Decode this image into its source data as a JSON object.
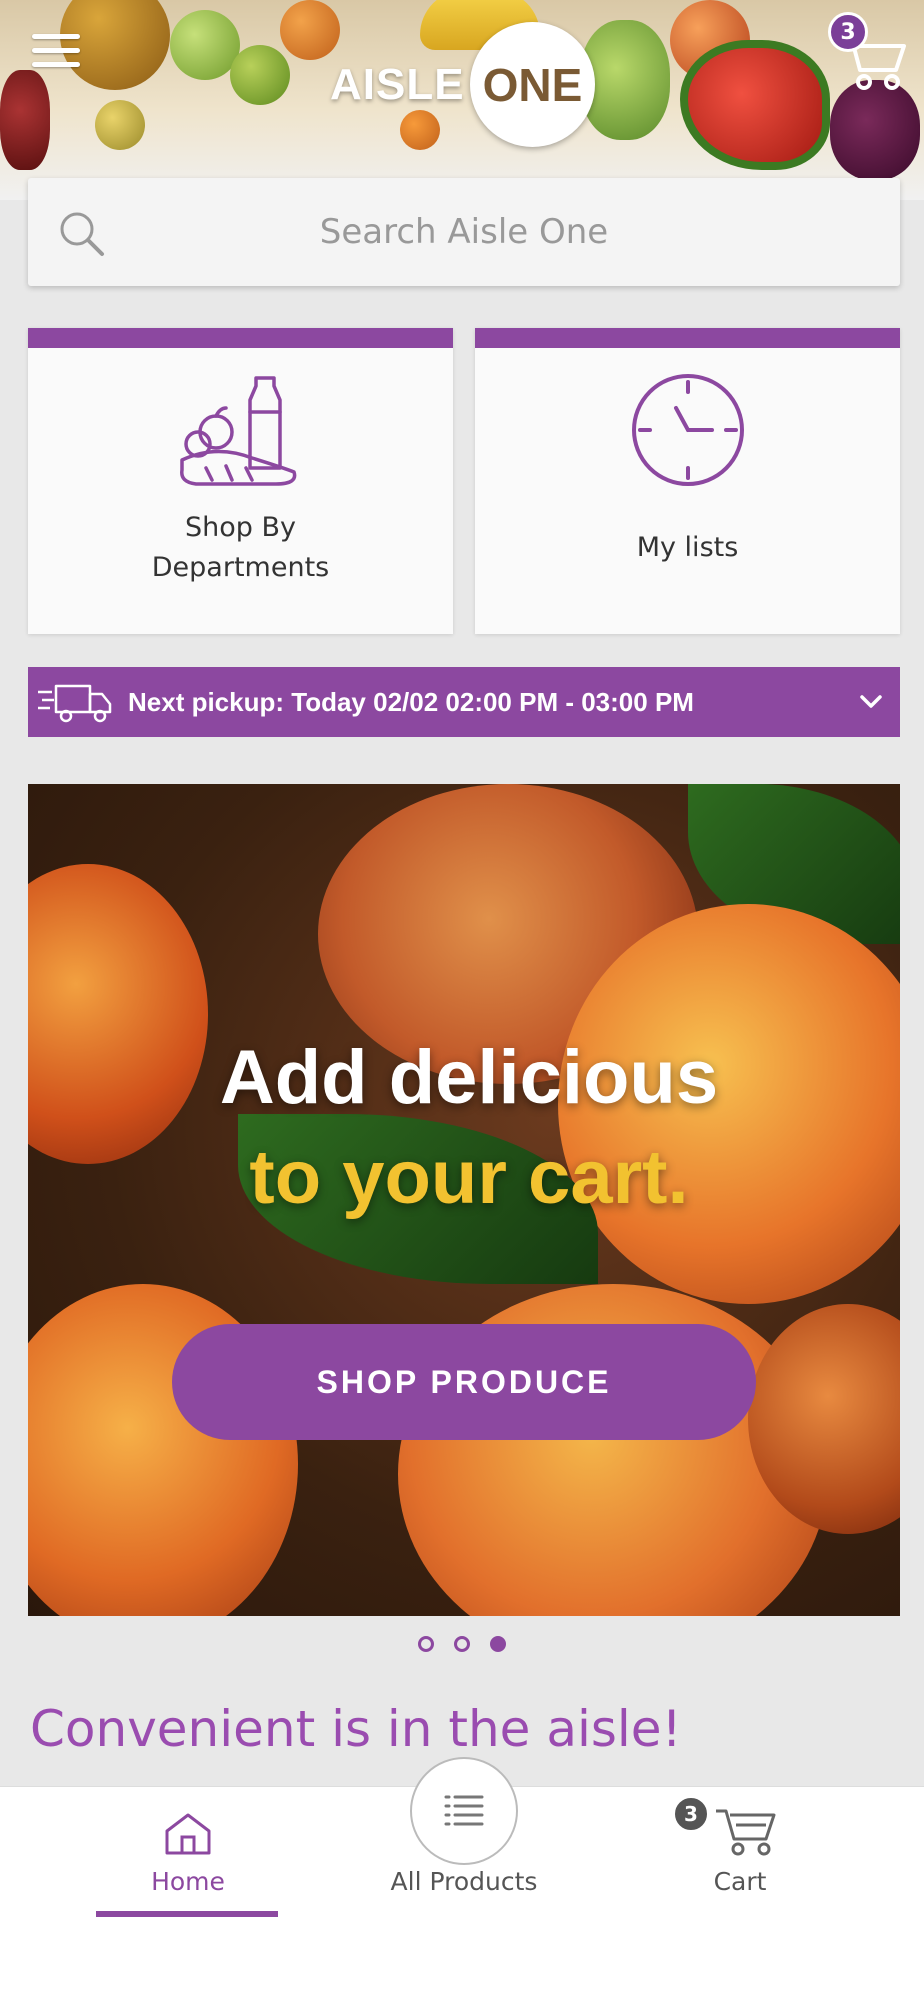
{
  "header": {
    "logo_text_left": "AISLE",
    "logo_text_right": "ONE",
    "cart_count": "3"
  },
  "search": {
    "placeholder": "Search Aisle One"
  },
  "tiles": [
    {
      "label_line1": "Shop By",
      "label_line2": "Departments",
      "icon": "groceries-icon"
    },
    {
      "label": "My lists",
      "icon": "clock-icon"
    }
  ],
  "pickup": {
    "text": "Next pickup: Today 02/02 02:00 PM - 03:00 PM",
    "icon": "delivery-truck-icon"
  },
  "promo": {
    "line1": "Add delicious",
    "line2": "to your cart.",
    "button_label": "SHOP PRODUCE"
  },
  "carousel": {
    "slide_count": 3,
    "active_index": 2
  },
  "section": {
    "title": "Convenient is in the aisle!"
  },
  "bottom_nav": {
    "home_label": "Home",
    "all_products_label": "All Products",
    "cart_label": "Cart",
    "cart_count": "3",
    "active": "home"
  },
  "colors": {
    "brand_purple": "#8c48a0",
    "promo_yellow": "#f2c230",
    "badge_purple": "#7b3f98"
  }
}
